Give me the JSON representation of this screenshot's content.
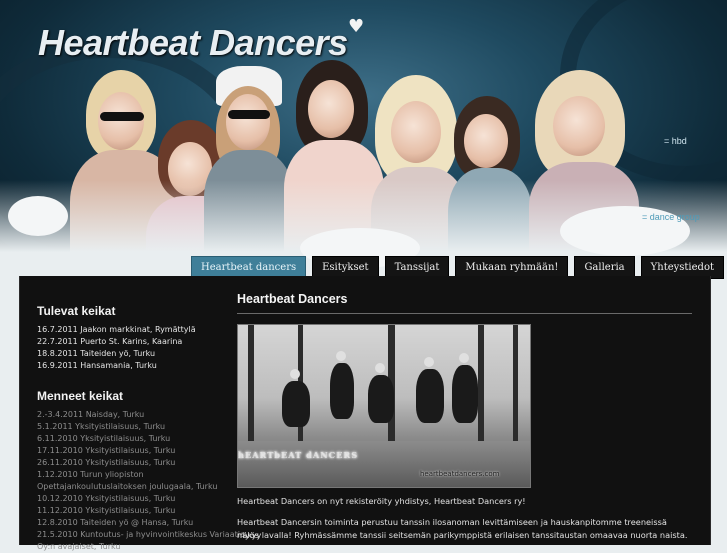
{
  "header": {
    "site_title": "Heartbeat Dancers",
    "tag_hbd": "= hbd",
    "tag_group": "= dance group"
  },
  "nav": {
    "items": [
      {
        "label": "Heartbeat dancers",
        "active": true
      },
      {
        "label": "Esitykset",
        "active": false
      },
      {
        "label": "Tanssijat",
        "active": false
      },
      {
        "label": "Mukaan ryhmään!",
        "active": false
      },
      {
        "label": "Galleria",
        "active": false
      },
      {
        "label": "Yhteystiedot",
        "active": false
      }
    ]
  },
  "sidebar": {
    "upcoming_heading": "Tulevat keikat",
    "upcoming": [
      "16.7.2011 Jaakon markkinat, Rymättylä",
      "22.7.2011 Puerto St. Karins, Kaarina",
      "18.8.2011 Taiteiden yö, Turku",
      "16.9.2011 Hansamania, Turku"
    ],
    "past_heading": "Menneet keikat",
    "past": [
      "2.-3.4.2011 Naisday, Turku",
      "5.1.2011 Yksityistilaisuus, Turku",
      "6.11.2010 Yksityistilaisuus, Turku",
      "17.11.2010 Yksityistilaisuus, Turku",
      "26.11.2010 Yksityistilaisuus, Turku",
      "1.12.2010 Turun yliopiston",
      "Opettajankoulutuslaitoksen joulugaala, Turku",
      "10.12.2010 Yksityistilaisuus, Turku",
      "11.12.2010 Yksityistilaisuus, Turku",
      "12.8.2010 Taiteiden yö @ Hansa, Turku",
      "21.5.2010 Kuntoutus- ja hyvinvointikeskus Variaatio",
      "Oy:n avajaiset, Turku"
    ]
  },
  "main": {
    "title": "Heartbeat Dancers",
    "photo_logo": "hEARTbEAT dANCERS",
    "photo_url": "heartbeatdancers.com",
    "paragraph1": "Heartbeat Dancers on nyt rekisteröity yhdistys, Heartbeat Dancers ry!",
    "paragraph2_line1": "Heartbeat Dancersin toiminta perustuu tanssin ilosanoman levittämiseen ja hauskanpitomme treeneissä näkyy",
    "paragraph2_line2": "myös lavalla! Ryhmässämme tanssii seitsemän parikymppistä erilaisen tanssitaustan omaavaa nuorta naista."
  },
  "colors": {
    "active_tab": "#3f7f99",
    "panel_bg": "#111111",
    "header_bg": "#1f4a60"
  }
}
